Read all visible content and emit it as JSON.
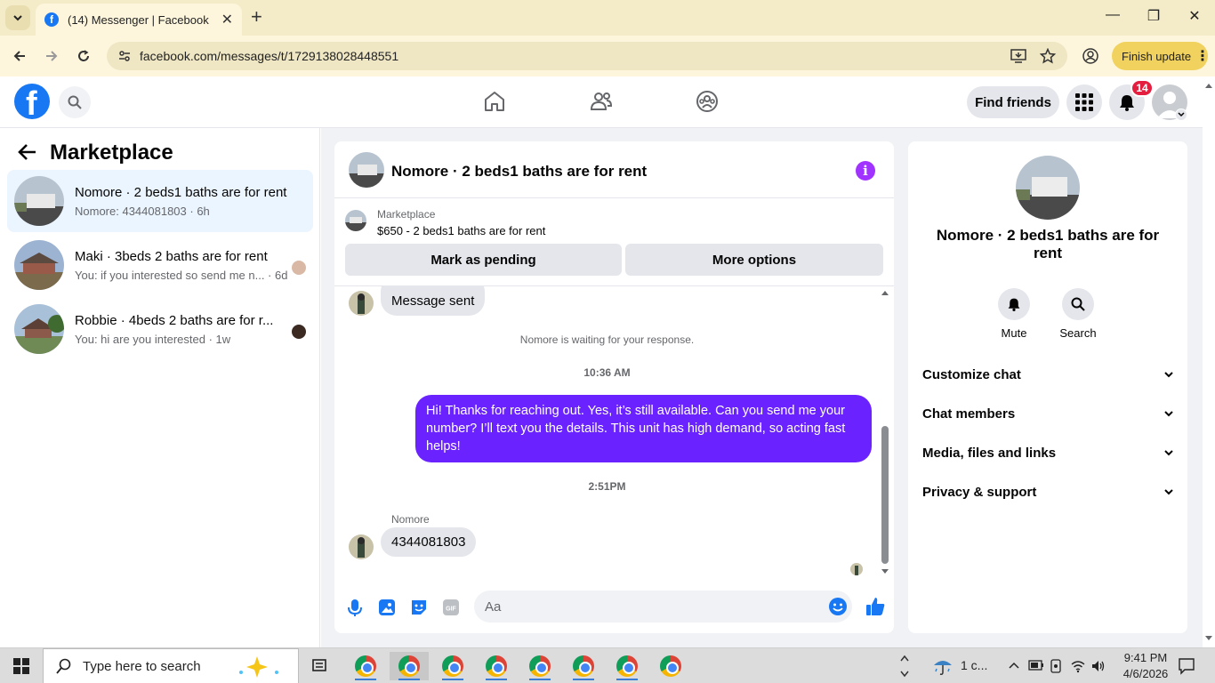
{
  "browser": {
    "tab_title": "(14) Messenger | Facebook",
    "url": "facebook.com/messages/t/1729138028448551",
    "finish_update_label": "Finish update"
  },
  "header": {
    "find_friends_label": "Find friends",
    "notification_count": "14"
  },
  "left_panel": {
    "title": "Marketplace",
    "conversations": [
      {
        "name": "Nomore · 2 beds1 baths are for rent",
        "snippet": "Nomore: 4344081803 · 6h",
        "active": true
      },
      {
        "name": "Maki · 3beds 2 baths are for rent",
        "snippet": "You: if you interested so send me n... · 6d",
        "active": false
      },
      {
        "name": "Robbie · 4beds 2 baths are for r...",
        "snippet": "You: hi are you interested · 1w",
        "active": false
      }
    ]
  },
  "chat": {
    "title": "Nomore · 2 beds1 baths are for rent",
    "listing_label": "Marketplace",
    "listing_price": "$650 - 2 beds1 baths are for rent",
    "mark_pending_label": "Mark as pending",
    "more_options_label": "More options",
    "messages": {
      "sent_notice": "Message sent",
      "waiting_notice": "Nomore is waiting for your response.",
      "time1": "10:36 AM",
      "outgoing_text": "Hi! Thanks for reaching out. Yes, it’s still available. Can you send me your number? I’ll text you the details. This unit has high demand, so acting fast helps!",
      "time2": "2:51PM",
      "sender_name": "Nomore",
      "incoming_text": "4344081803"
    },
    "composer_placeholder": "Aa"
  },
  "right_panel": {
    "name": "Nomore · 2 beds1 baths are for rent",
    "mute_label": "Mute",
    "search_label": "Search",
    "sections": [
      "Customize chat",
      "Chat members",
      "Media, files and links",
      "Privacy & support"
    ]
  },
  "taskbar": {
    "search_placeholder": "Type here to search",
    "weather": "1 c...",
    "time": "9:41 PM",
    "date": "4/6/2026"
  },
  "colors": {
    "fb_blue": "#1877f2",
    "outgoing_bubble": "#6a22ff",
    "info_purple": "#a033ff",
    "active_conversation": "#ebf5ff",
    "badge_red": "#e41e3f"
  }
}
